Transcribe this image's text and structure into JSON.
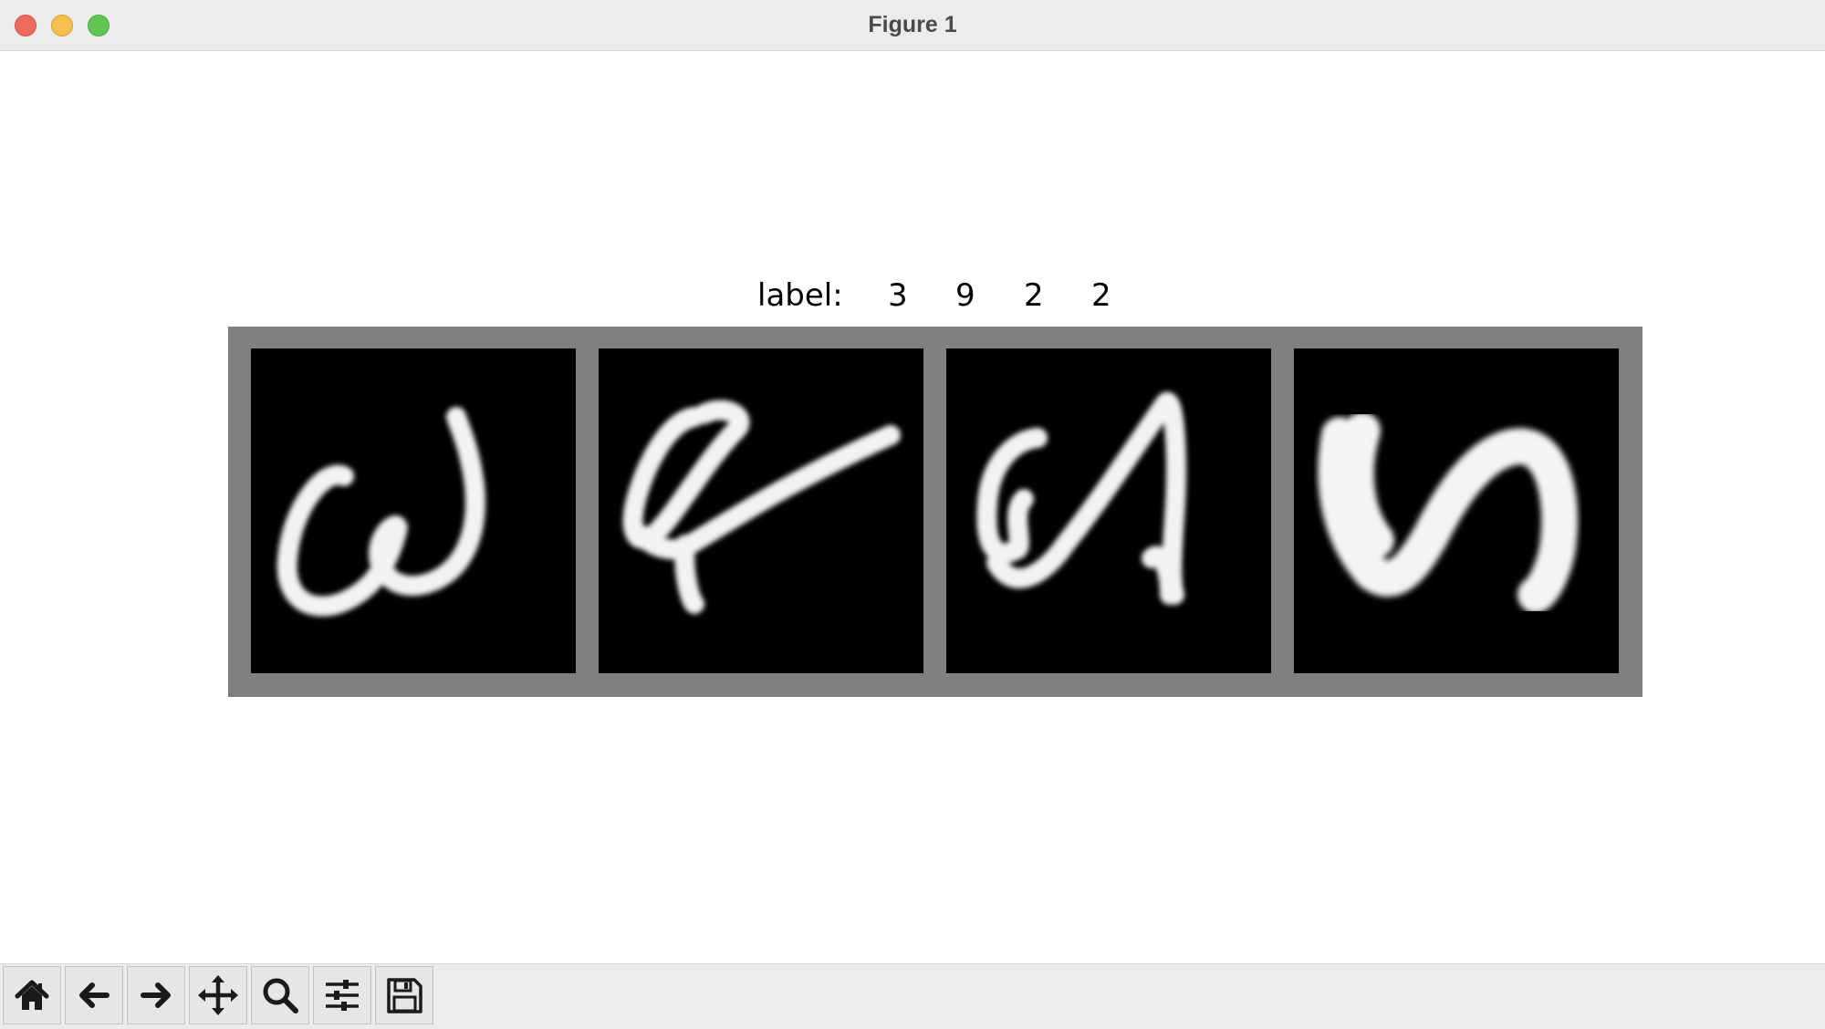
{
  "window": {
    "title": "Figure 1"
  },
  "figure": {
    "label_prefix": "label:",
    "labels": [
      "3",
      "9",
      "2",
      "2"
    ],
    "images": [
      {
        "name": "digit-image-1",
        "label": "3"
      },
      {
        "name": "digit-image-2",
        "label": "9"
      },
      {
        "name": "digit-image-3",
        "label": "2"
      },
      {
        "name": "digit-image-4",
        "label": "2"
      }
    ]
  },
  "toolbar": {
    "buttons": [
      {
        "name": "home-button",
        "icon": "home-icon"
      },
      {
        "name": "back-button",
        "icon": "arrow-left-icon"
      },
      {
        "name": "forward-button",
        "icon": "arrow-right-icon"
      },
      {
        "name": "pan-button",
        "icon": "move-icon"
      },
      {
        "name": "zoom-button",
        "icon": "magnifier-icon"
      },
      {
        "name": "configure-subplots-button",
        "icon": "sliders-icon"
      },
      {
        "name": "save-button",
        "icon": "floppy-disk-icon"
      }
    ]
  },
  "colors": {
    "frame": "#808080",
    "tile_background": "#000000",
    "stroke": "#f2f2f2"
  }
}
